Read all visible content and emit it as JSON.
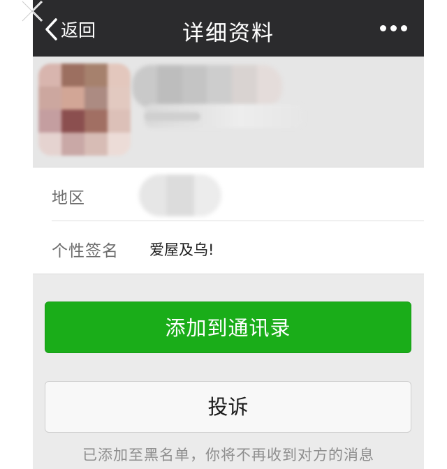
{
  "nav": {
    "back_label": "返回",
    "title": "详细资料"
  },
  "profile": {
    "avatar_colors": [
      "#d8b5ae",
      "#9c6f60",
      "#a6816d",
      "#e3c7bd",
      "#cca79f",
      "#d2a696",
      "#ac8b82",
      "#e2c9c0",
      "#c49ea0",
      "#8b4f4f",
      "#a16f63",
      "#dcc0b8",
      "#e5d3d0",
      "#c9a8a6",
      "#d7bcb5",
      "#ecdcd7"
    ],
    "name_blur_colors": [
      "#c9c9c9",
      "#bdbdbd",
      "#c4c4c4",
      "#cdcdcd",
      "#d9d3d1",
      "#e4dcda"
    ],
    "region_blur_colors": [
      "#e6e6e6",
      "#dcdcdc",
      "#ececec"
    ]
  },
  "info": {
    "region_label": "地区",
    "signature_label": "个性签名",
    "signature_value": "爱屋及乌!"
  },
  "actions": {
    "add_contact_label": "添加到通讯录",
    "report_label": "投诉"
  },
  "notice": "已添加至黑名单，你将不再收到对方的消息",
  "colors": {
    "nav_bg": "#2b2b2d",
    "primary_green": "#1aad19",
    "page_bg": "#ebebeb"
  }
}
